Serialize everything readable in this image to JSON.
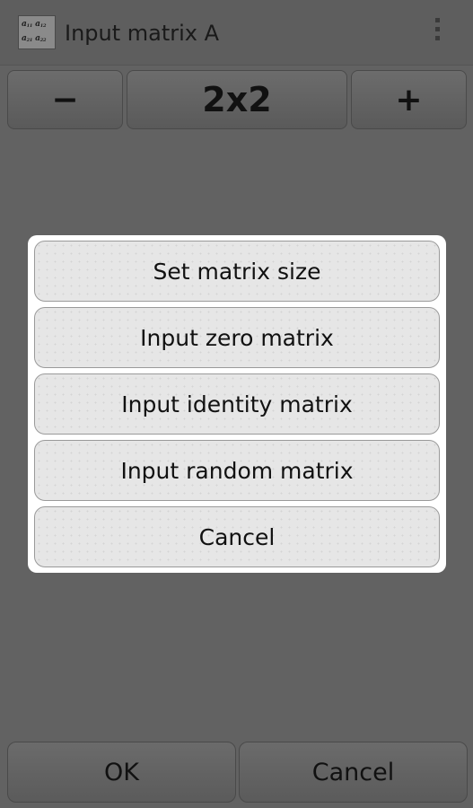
{
  "actionbar": {
    "title": "Input matrix A",
    "icon": "matrix-icon",
    "overflow_icon": "overflow-menu-icon"
  },
  "size_controls": {
    "decrement_label": "−",
    "size_value": "2x2",
    "increment_label": "+"
  },
  "dialog": {
    "items": [
      {
        "label": "Set matrix size"
      },
      {
        "label": "Input zero matrix"
      },
      {
        "label": "Input identity matrix"
      },
      {
        "label": "Input random matrix"
      },
      {
        "label": "Cancel"
      }
    ]
  },
  "footer": {
    "ok_label": "OK",
    "cancel_label": "Cancel"
  },
  "colors": {
    "dim_background": "#626262",
    "dialog_background": "#ffffff",
    "dialog_button": "#e6e6e6"
  }
}
